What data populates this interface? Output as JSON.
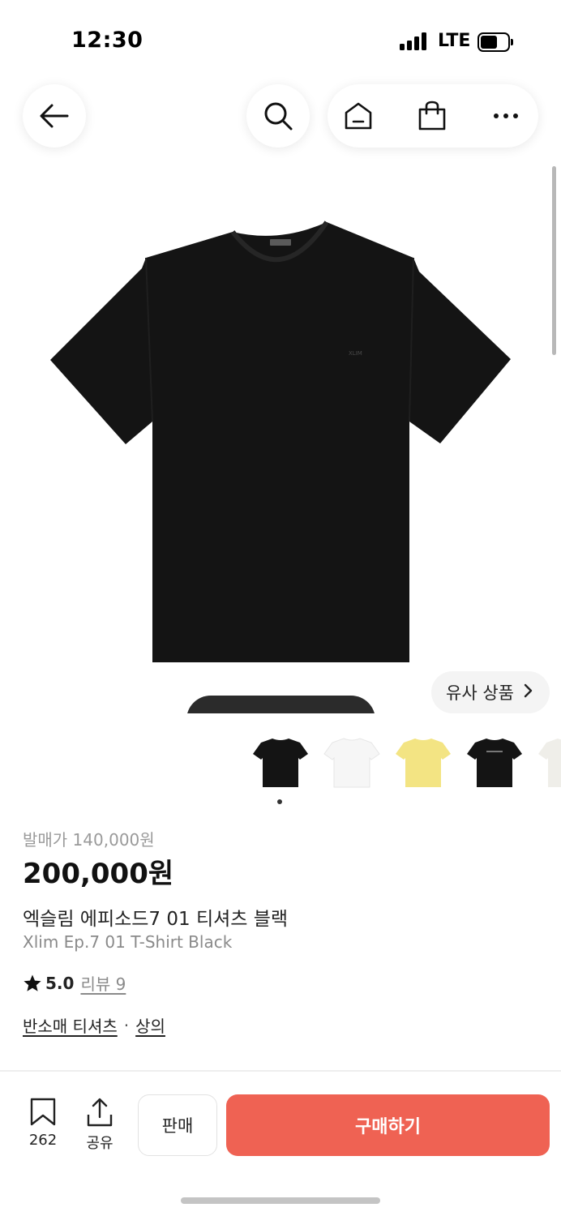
{
  "status_bar": {
    "time": "12:30",
    "network": "LTE"
  },
  "nav": {
    "back_icon": "arrow-left-icon",
    "search_icon": "search-icon",
    "home_icon": "home-icon",
    "cart_icon": "shopping-bag-icon",
    "more_icon": "more-horizontal-icon"
  },
  "product": {
    "similar_label": "유사 상품",
    "release_label": "발매가 140,000원",
    "price": "200,000원",
    "name_ko": "엑슬림 에피소드7 01 티셔츠 블랙",
    "name_en": "Xlim Ep.7 01 T-Shirt Black",
    "rating": "5.0",
    "review_label": "리뷰 9",
    "category": "반소매 티셔츠",
    "category_sep": "·",
    "category_parent": "상의",
    "logo_text": "XLIM"
  },
  "thumbnails": [
    {
      "color": "#141414",
      "name": "black"
    },
    {
      "color": "#f6f6f6",
      "name": "white"
    },
    {
      "color": "#f3e483",
      "name": "yellow"
    },
    {
      "color": "#141414",
      "name": "black-print"
    },
    {
      "color": "#efeee9",
      "name": "cream"
    }
  ],
  "bottom_bar": {
    "bookmark_count": "262",
    "share_label": "공유",
    "sell_label": "판매",
    "buy_label": "구매하기"
  },
  "colors": {
    "accent": "#ef6253",
    "shirt": "#141414"
  }
}
